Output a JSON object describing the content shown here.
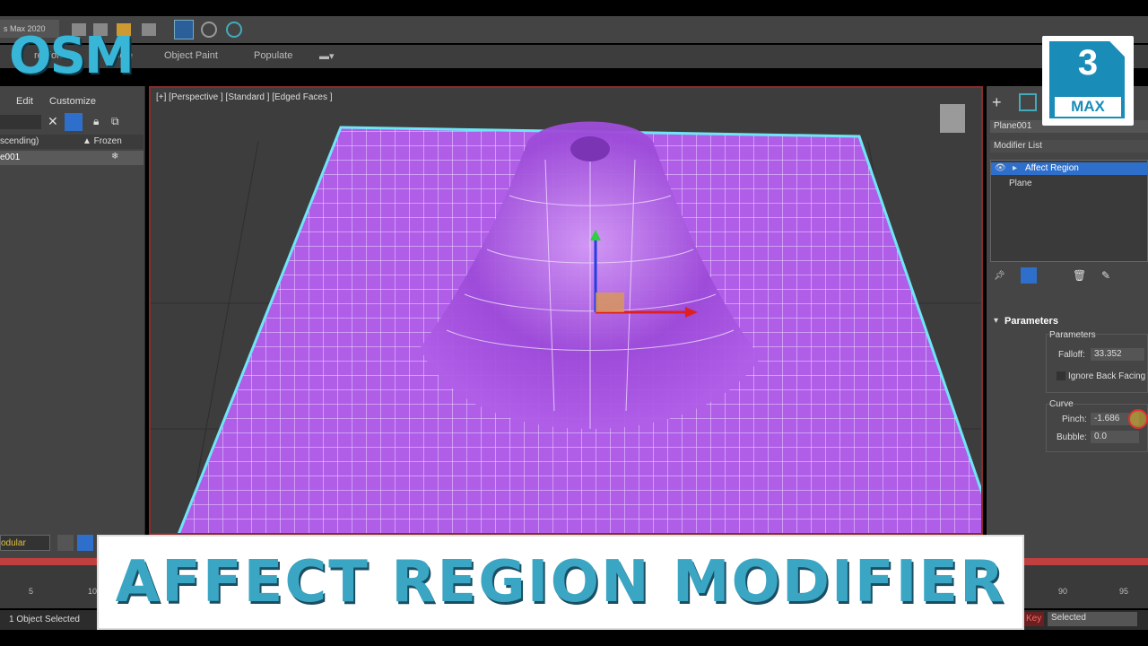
{
  "ribbon": {
    "object_paint": "Object Paint",
    "populate": "Populate",
    "reeform": "reeform",
    "sele": "Sele",
    "workspace": "s Max 2020"
  },
  "scene_explorer": {
    "menu_edit": "Edit",
    "menu_customize": "Customize",
    "col_sort": "scending)",
    "col_frozen": "▲ Frozen",
    "row_name": "e001"
  },
  "viewport": {
    "label": "[+] [Perspective ] [Standard ] [Edged Faces ]"
  },
  "command_panel": {
    "object_name": "Plane001",
    "modifier_list": "Modifier List",
    "stack": [
      {
        "label": "Affect Region",
        "selected": true
      },
      {
        "label": "Plane",
        "selected": false
      }
    ],
    "rollout_title": "Parameters",
    "group_parameters": "Parameters",
    "falloff_label": "Falloff:",
    "falloff_value": "33.352",
    "ignore_back_facing": "Ignore Back Facing",
    "group_curve": "Curve",
    "pinch_label": "Pinch:",
    "pinch_value": "-1.686",
    "bubble_label": "Bubble:",
    "bubble_value": "0.0"
  },
  "timeline": {
    "ticks": [
      "5",
      "10",
      "90",
      "95"
    ]
  },
  "status": {
    "selection": "1 Object Selected",
    "key": "Key",
    "key_filter": "Selected",
    "modular": "odular"
  },
  "overlay": {
    "title": "AFFECT REGION MODIFIER",
    "channel": "OSM",
    "logo_number": "3",
    "logo_text": "MAX"
  },
  "colors": {
    "mesh": "#b05ee8",
    "accent": "#3aa6c4",
    "selected": "#2e6fcc"
  }
}
